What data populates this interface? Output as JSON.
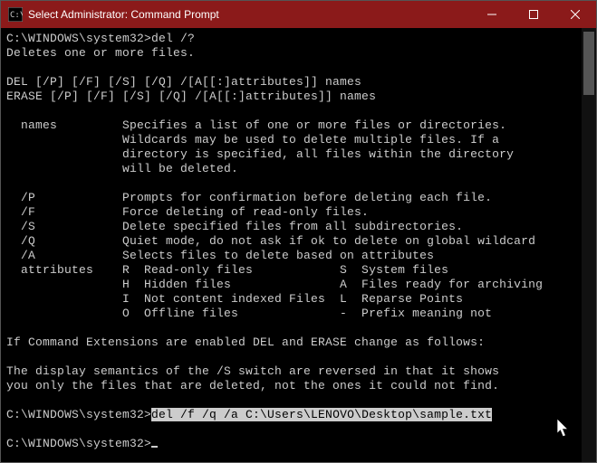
{
  "titlebar": {
    "title": "Select Administrator: Command Prompt"
  },
  "terminal": {
    "line1a": "C:\\WINDOWS\\system32>",
    "line1b": "del /?",
    "line2": "Deletes one or more files.",
    "line4": "DEL [/P] [/F] [/S] [/Q] /[A[[:]attributes]] names",
    "line5": "ERASE [/P] [/F] [/S] [/Q] /[A[[:]attributes]] names",
    "line7": "  names         Specifies a list of one or more files or directories.",
    "line8": "                Wildcards may be used to delete multiple files. If a",
    "line9": "                directory is specified, all files within the directory",
    "line10": "                will be deleted.",
    "line12": "  /P            Prompts for confirmation before deleting each file.",
    "line13": "  /F            Force deleting of read-only files.",
    "line14": "  /S            Delete specified files from all subdirectories.",
    "line15": "  /Q            Quiet mode, do not ask if ok to delete on global wildcard",
    "line16": "  /A            Selects files to delete based on attributes",
    "line17": "  attributes    R  Read-only files            S  System files",
    "line18": "                H  Hidden files               A  Files ready for archiving",
    "line19": "                I  Not content indexed Files  L  Reparse Points",
    "line20": "                O  Offline files              -  Prefix meaning not",
    "line22": "If Command Extensions are enabled DEL and ERASE change as follows:",
    "line24": "The display semantics of the /S switch are reversed in that it shows",
    "line25": "you only the files that are deleted, not the ones it could not find.",
    "line27a": "C:\\WINDOWS\\system32>",
    "line27b": "del /f /q /a C:\\Users\\LENOVO\\Desktop\\sample.txt",
    "line29a": "C:\\WINDOWS\\system32>"
  }
}
